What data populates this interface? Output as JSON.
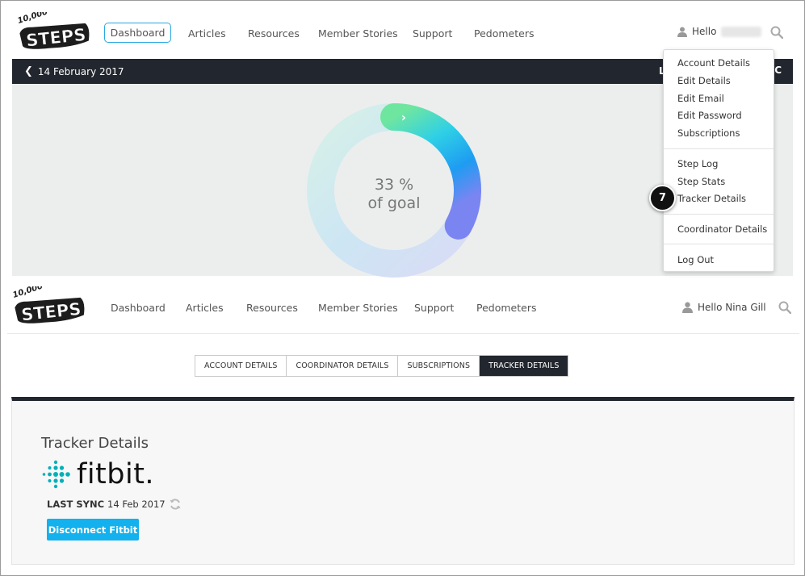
{
  "top_nav": {
    "logo_text": "10,000 STEPS",
    "active_button": "Dashboard",
    "items": [
      "Articles",
      "Resources",
      "Member Stories",
      "Support",
      "Pedometers"
    ],
    "greeting": "Hello"
  },
  "date_bar": {
    "date": "14 February 2017"
  },
  "progress": {
    "percent_label": "33 %",
    "goal_label": "of goal",
    "value": 0.33
  },
  "dropdown": {
    "group1": [
      "Account Details",
      "Edit Details",
      "Edit Email",
      "Edit Password",
      "Subscriptions"
    ],
    "group2": [
      "Step Log",
      "Step Stats",
      "Tracker Details"
    ],
    "group3": [
      "Coordinator Details"
    ],
    "group4": [
      "Log Out"
    ]
  },
  "step_badge": "7",
  "second_nav": {
    "logo_text": "10,000 STEPS",
    "items": [
      "Dashboard",
      "Articles",
      "Resources",
      "Member Stories",
      "Support",
      "Pedometers"
    ],
    "greeting": "Hello Nina Gill"
  },
  "tabs": [
    "ACCOUNT DETAILS",
    "COORDINATOR DETAILS",
    "SUBSCRIPTIONS",
    "TRACKER DETAILS"
  ],
  "active_tab": "TRACKER DETAILS",
  "tracker": {
    "title": "Tracker Details",
    "brand": "fitbit.",
    "last_sync_label": "LAST SYNC",
    "last_sync_value": "14 Feb 2017",
    "disconnect_label": "Disconnect Fitbit"
  },
  "colors": {
    "accent": "#27a9e1",
    "dark_bar": "#22262e",
    "disconnect": "#13b1ee",
    "fitbit_teal": "#00b0b9"
  }
}
